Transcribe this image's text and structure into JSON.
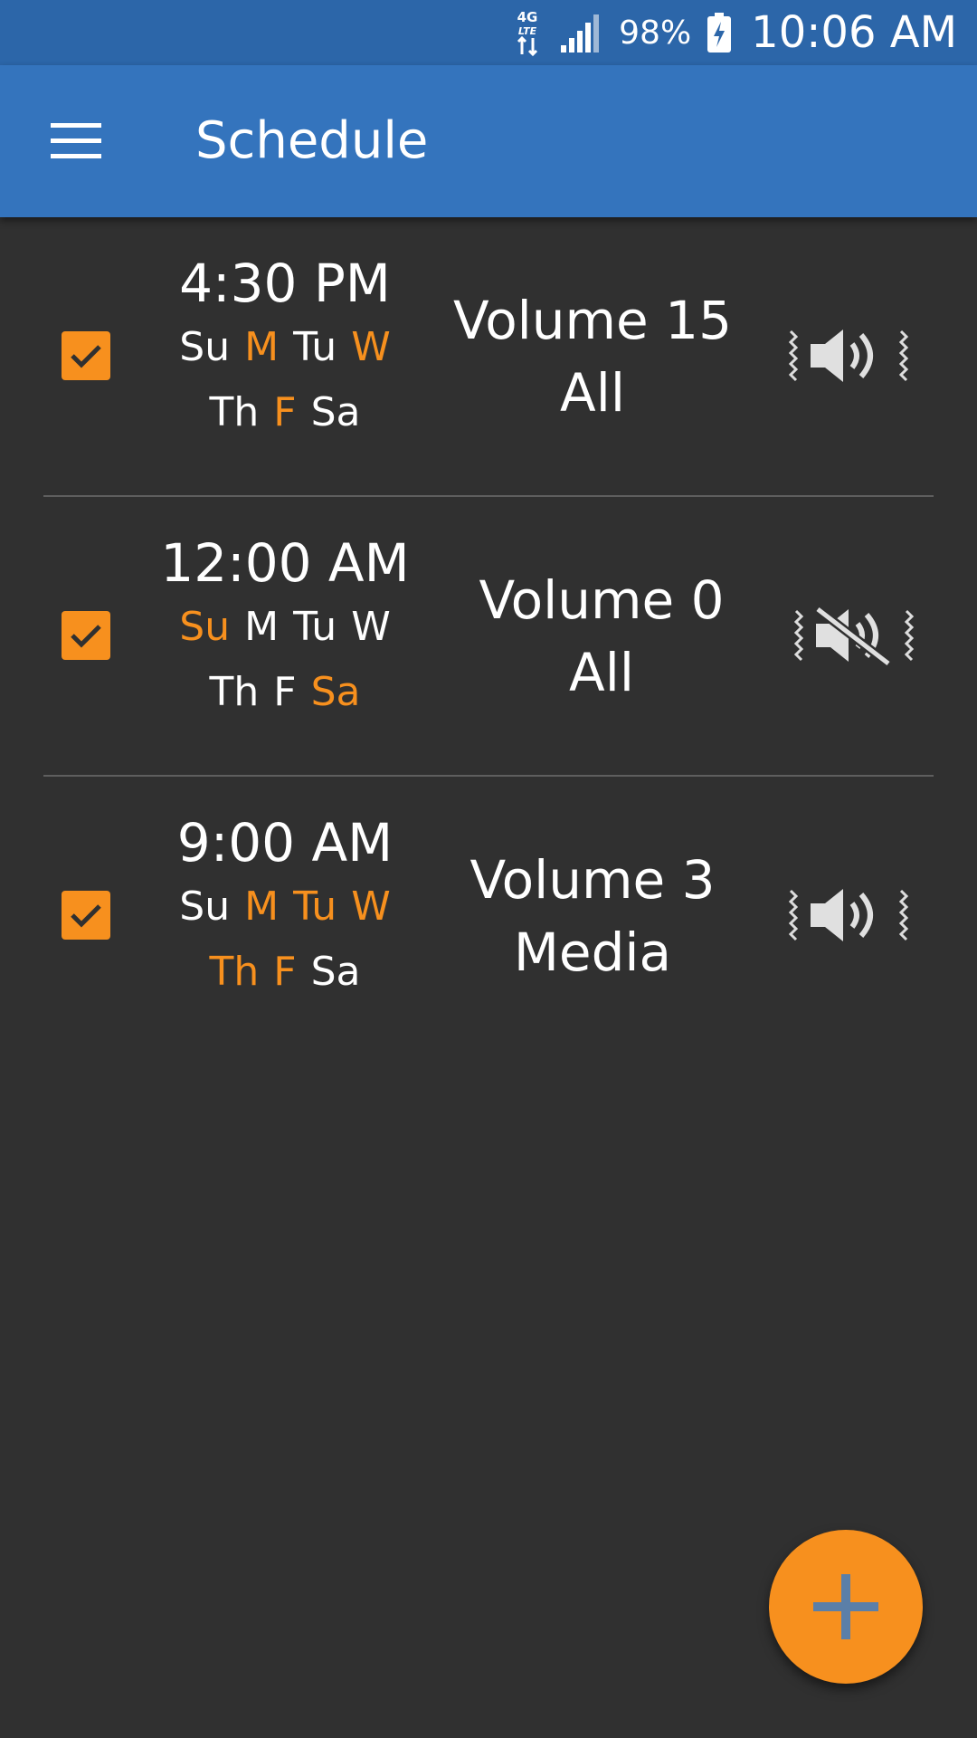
{
  "status_bar": {
    "network": "4G LTE",
    "battery": "98%",
    "time": "10:06 AM"
  },
  "app_bar": {
    "title": "Schedule",
    "menu_icon": "hamburger-menu-icon"
  },
  "colors": {
    "status_bar": "#2c66a9",
    "app_bar": "#3474bd",
    "background": "#303030",
    "accent": "#f7901e",
    "text": "#ffffff"
  },
  "schedules": [
    {
      "enabled": true,
      "time": "4:30 PM",
      "days_line1": [
        {
          "label": "Su",
          "active": false
        },
        {
          "label": "M",
          "active": true
        },
        {
          "label": "Tu",
          "active": false
        },
        {
          "label": "W",
          "active": true
        }
      ],
      "days_line2": [
        {
          "label": "Th",
          "active": false
        },
        {
          "label": "F",
          "active": true
        },
        {
          "label": "Sa",
          "active": false
        }
      ],
      "volume": "Volume 15",
      "stream": "All",
      "mode_icon": "volume-vibrate-icon"
    },
    {
      "enabled": true,
      "time": "12:00 AM",
      "days_line1": [
        {
          "label": "Su",
          "active": true
        },
        {
          "label": "M",
          "active": false
        },
        {
          "label": "Tu",
          "active": false
        },
        {
          "label": "W",
          "active": false
        }
      ],
      "days_line2": [
        {
          "label": "Th",
          "active": false
        },
        {
          "label": "F",
          "active": false
        },
        {
          "label": "Sa",
          "active": true
        }
      ],
      "volume": "Volume 0",
      "stream": "All",
      "mode_icon": "mute-vibrate-icon"
    },
    {
      "enabled": true,
      "time": "9:00 AM",
      "days_line1": [
        {
          "label": "Su",
          "active": false
        },
        {
          "label": "M",
          "active": true
        },
        {
          "label": "Tu",
          "active": true
        },
        {
          "label": "W",
          "active": true
        }
      ],
      "days_line2": [
        {
          "label": "Th",
          "active": true
        },
        {
          "label": "F",
          "active": true
        },
        {
          "label": "Sa",
          "active": false
        }
      ],
      "volume": "Volume 3",
      "stream": "Media",
      "mode_icon": "volume-vibrate-icon"
    }
  ],
  "fab": {
    "icon": "plus-icon"
  }
}
